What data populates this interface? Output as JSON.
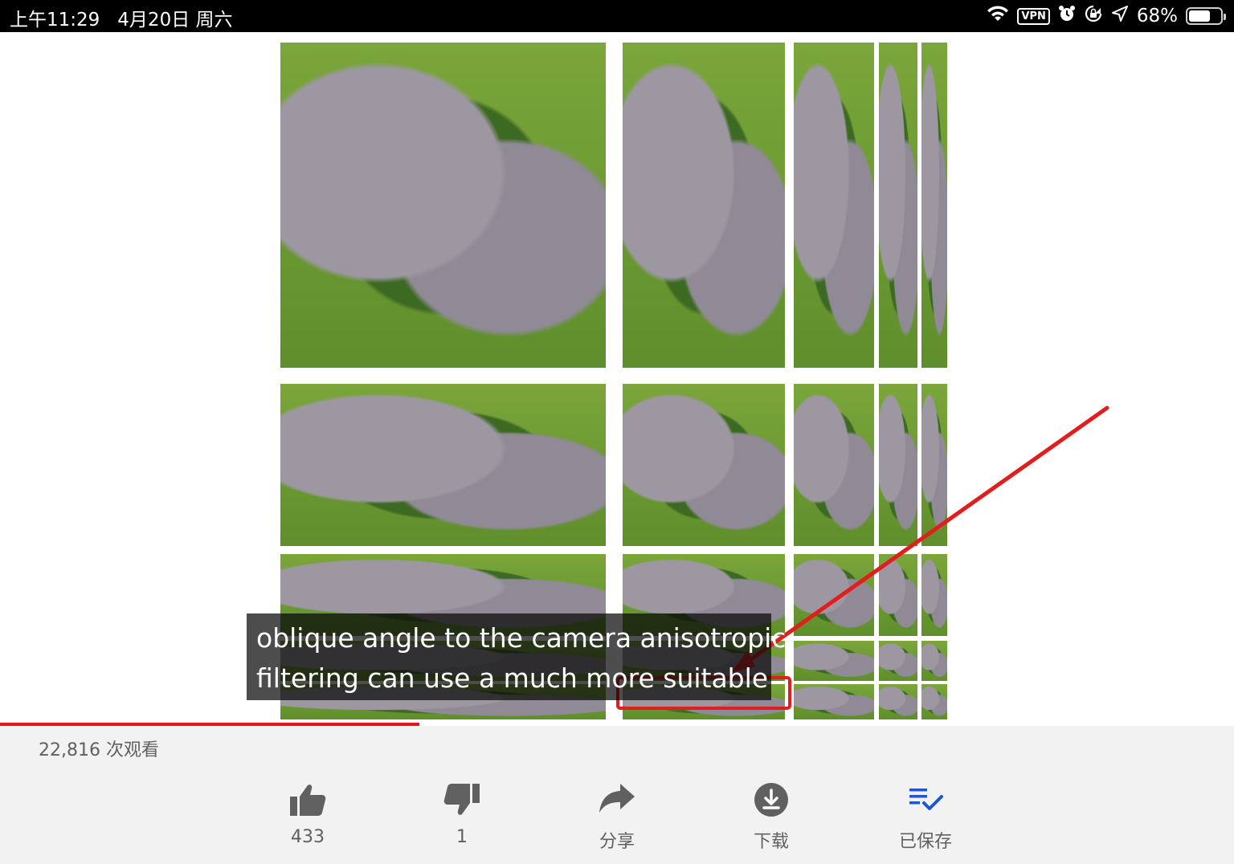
{
  "status_bar": {
    "time": "上午11:29",
    "date": "4月20日 周六",
    "vpn": "VPN",
    "battery_text": "68%",
    "battery_level": 0.68
  },
  "player": {
    "caption_line1": "oblique angle to the camera anisotropic",
    "caption_line2": "filtering can use a much more suitable",
    "progress": 0.34,
    "progress_color": "#e8121f",
    "annotation_color": "#e11d1d"
  },
  "info": {
    "views": "22,816 次观看"
  },
  "actions": {
    "like_count": "433",
    "dislike_count": "1",
    "share_label": "分享",
    "download_label": "下载",
    "saved_label": "已保存",
    "saved_color": "#1a56d6"
  }
}
